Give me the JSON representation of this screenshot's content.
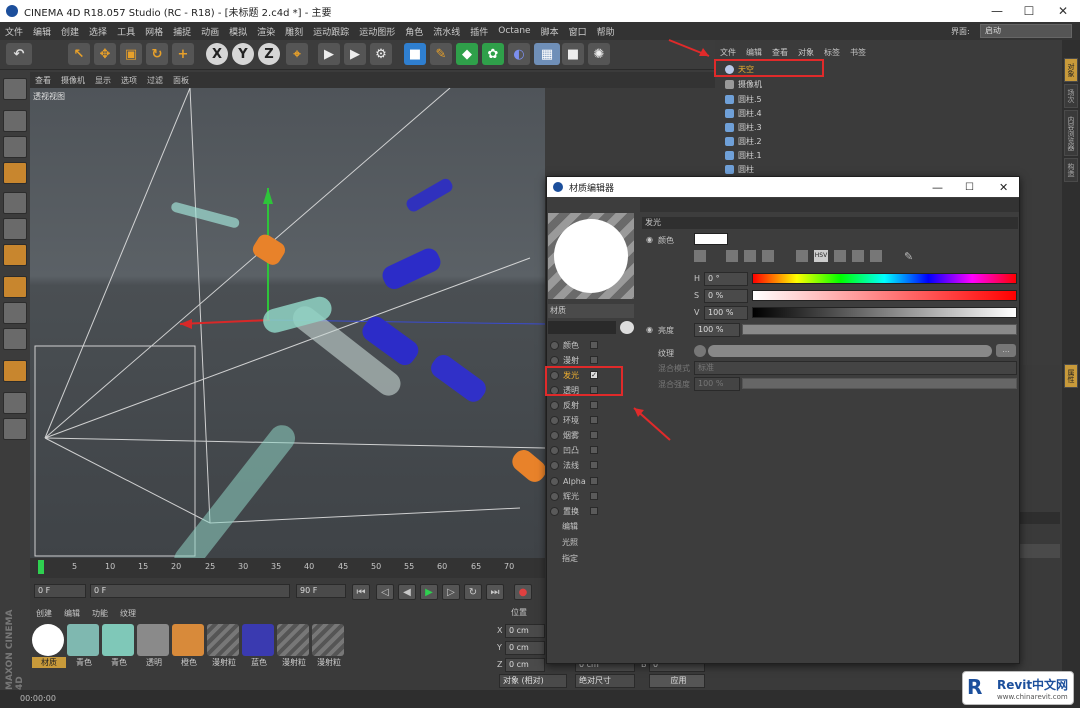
{
  "window": {
    "title": "CINEMA 4D R18.057 Studio (RC - R18) - [未标题 2.c4d *] - 主要",
    "min": "—",
    "max": "☐",
    "close": "✕"
  },
  "menu": [
    "文件",
    "编辑",
    "创建",
    "选择",
    "工具",
    "网格",
    "捕捉",
    "动画",
    "模拟",
    "渲染",
    "雕刻",
    "运动跟踪",
    "运动图形",
    "角色",
    "流水线",
    "插件",
    "Octane",
    "脚本",
    "窗口",
    "帮助"
  ],
  "layout": {
    "label": "界面:",
    "value": "启动"
  },
  "toolbar": {
    "x": "X",
    "y": "Y",
    "z": "Z"
  },
  "viewport": {
    "menu": [
      "查看",
      "摄像机",
      "显示",
      "选项",
      "过滤",
      "面板"
    ],
    "label": "透视视图"
  },
  "objects": {
    "menu": [
      "文件",
      "编辑",
      "查看",
      "对象",
      "标签",
      "书签"
    ],
    "items": [
      "天空",
      "摄像机",
      "圆柱.5",
      "圆柱.4",
      "圆柱.3",
      "圆柱.2",
      "圆柱.1",
      "圆柱"
    ]
  },
  "side_tabs": [
    "对象",
    "场次",
    "内容浏览器",
    "构造"
  ],
  "attr_tab": "属性",
  "timeline": {
    "ticks": [
      "0",
      "5",
      "10",
      "15",
      "20",
      "25",
      "30",
      "35",
      "40",
      "45",
      "50",
      "55",
      "60",
      "65",
      "70"
    ],
    "start": "0 F",
    "cur": "0 F",
    "end": "90 F",
    "end2": "90 F"
  },
  "materials": {
    "menu": [
      "创建",
      "编辑",
      "功能",
      "纹理"
    ],
    "items": [
      "材质",
      "青色",
      "青色",
      "透明",
      "橙色",
      "漫射粒",
      "蓝色",
      "漫射粒",
      "漫射粒"
    ]
  },
  "coords": {
    "header": "位置",
    "rows": [
      {
        "axis": "X",
        "value": "0 cm"
      },
      {
        "axis": "Y",
        "value": "0 cm"
      },
      {
        "axis": "Z",
        "value": "0 cm"
      }
    ],
    "extra_z": "0 cm",
    "b": "B",
    "b_val": "0 °",
    "mode1": "对象 (相对)",
    "mode2": "绝对尺寸",
    "apply": "应用"
  },
  "status": {
    "time": "00:00:00"
  },
  "brand": "MAXON CINEMA 4D",
  "material_editor": {
    "title": "材质编辑器",
    "name": "材质",
    "channel_header": "发光",
    "channels": [
      {
        "label": "颜色",
        "checked": false
      },
      {
        "label": "漫射",
        "checked": false
      },
      {
        "label": "发光",
        "checked": true
      },
      {
        "label": "透明",
        "checked": false
      },
      {
        "label": "反射",
        "checked": false
      },
      {
        "label": "环境",
        "checked": false
      },
      {
        "label": "烟雾",
        "checked": false
      },
      {
        "label": "凹凸",
        "checked": false
      },
      {
        "label": "法线",
        "checked": false
      },
      {
        "label": "Alpha",
        "checked": false
      },
      {
        "label": "辉光",
        "checked": false
      },
      {
        "label": "置换",
        "checked": false
      }
    ],
    "extra": [
      "编辑",
      "光照",
      "指定"
    ],
    "color_label": "颜色",
    "h_label": "H",
    "h_val": "0 °",
    "s_label": "S",
    "s_val": "0 %",
    "v_label": "V",
    "v_val": "100 %",
    "brightness_label": "亮度",
    "brightness_val": "100 %",
    "texture_label": "纹理",
    "texture_btn": "...",
    "blend_mode_label": "混合模式",
    "blend_mode_val": "标准",
    "blend_strength_label": "混合强度",
    "blend_strength_val": "100 %",
    "hsv": "HSV"
  },
  "watermark": {
    "brand": "Revit中文网",
    "url": "www.chinarevit.com"
  }
}
